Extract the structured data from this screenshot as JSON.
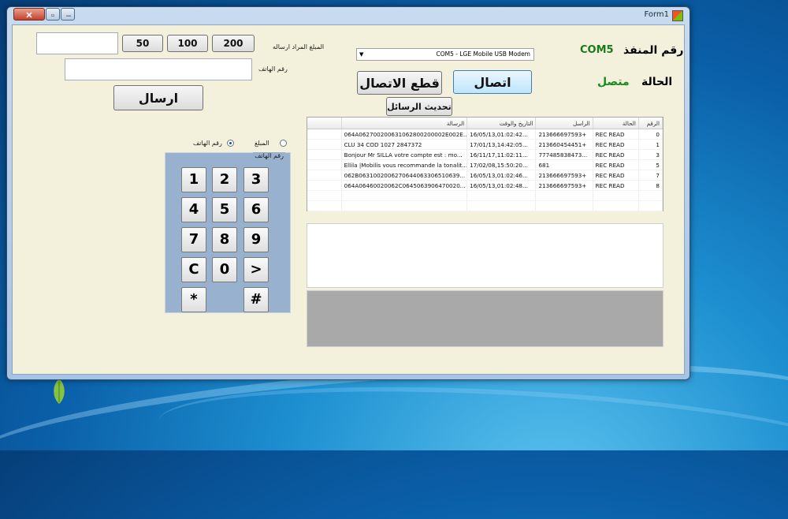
{
  "window": {
    "title": "Form1"
  },
  "buttons": {
    "amount_200": "200",
    "amount_100": "100",
    "amount_50": "50",
    "send": "ارسال",
    "connect": "اتصال",
    "disconnect": "قطع الاتصال",
    "refresh_messages": "تحديث الرسائل"
  },
  "labels": {
    "amount_to_send": "المبلغ المراد ارساله",
    "phone_number": "رقم الهاتف",
    "port_number": "رقم المنفذ",
    "port_value": "COM5",
    "status": "الحالة",
    "status_value": "متصل",
    "radio_phone": "رقم الهاتف",
    "radio_amount": "المبلغ",
    "keypad_group": "رقم الهاتف"
  },
  "inputs": {
    "amount": "",
    "phone": ""
  },
  "port_select": {
    "selected": "COM5 - LGE Mobile USB Modem"
  },
  "table": {
    "headers": {
      "num": "الرقم",
      "status": "الحالة",
      "sender": "الراسل",
      "datetime": "التاريخ والوقت",
      "message": "الرسالة"
    },
    "rows": [
      {
        "num": "0",
        "status": "REC READ",
        "sender": "213666697593+",
        "datetime": "16/05/13,01:02:42...",
        "message": "064A062700200631062800200002E002E..."
      },
      {
        "num": "1",
        "status": "REC READ",
        "sender": "213660454451+",
        "datetime": "17/01/13,14:42:05...",
        "message": "CLU 34      COD 1027  2847372"
      },
      {
        "num": "3",
        "status": "REC READ",
        "sender": "777485838473...",
        "datetime": "16/11/17,11:02:11...",
        "message": "Bonjour Mr SILLA votre compte est : mo..."
      },
      {
        "num": "5",
        "status": "REC READ",
        "sender": "681",
        "datetime": "17/02/08,15:50:20...",
        "message": "Ellila  |Mobilis vous recommande la tonalit..."
      },
      {
        "num": "7",
        "status": "REC READ",
        "sender": "213666697593+",
        "datetime": "16/05/13,01:02:46...",
        "message": "062B0631002006270644063306510639..."
      },
      {
        "num": "8",
        "status": "REC READ",
        "sender": "213666697593+",
        "datetime": "16/05/13,01:02:48...",
        "message": "064A06460020062C0645063906470020..."
      }
    ]
  },
  "keypad": {
    "keys": [
      [
        "1",
        "2",
        "3"
      ],
      [
        "4",
        "5",
        "6"
      ],
      [
        "7",
        "8",
        "9"
      ],
      [
        "C",
        "0",
        ">"
      ],
      [
        "*",
        "",
        "#"
      ]
    ]
  },
  "colors": {
    "port_value": "#1a7a1a",
    "status_value": "#1a8a1a",
    "form_bg": "#f3f1dc",
    "keypad_bg": "#97b1cf"
  }
}
